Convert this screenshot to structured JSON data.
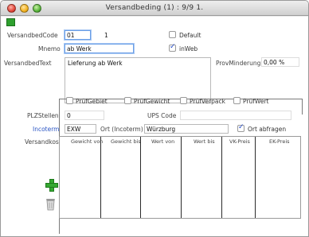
{
  "window": {
    "title": "Versandbeding (1) : 9/9 1."
  },
  "form": {
    "code_label": "VersandbedCode",
    "code_value": "01",
    "code_number": "1",
    "default_label": "Default",
    "default_checked": false,
    "mnemo_label": "Mnemo",
    "mnemo_value": "ab Werk",
    "inweb_label": "inWeb",
    "inweb_checked": true,
    "text_label": "VersandbedText",
    "text_value": "Lieferung ab Werk",
    "minderung_label": "ProvMinderung",
    "minderung_value": "0,00 %"
  },
  "checks": [
    {
      "label": "PrüfGebiet",
      "checked": false
    },
    {
      "label": "PrüfGewicht",
      "checked": false
    },
    {
      "label": "PrüfVerpack",
      "checked": false
    },
    {
      "label": "PrüfWert",
      "checked": false
    }
  ],
  "shipping": {
    "plz_label": "PLZStellen",
    "plz_value": "0",
    "ups_label": "UPS Code",
    "ups_value": "",
    "incoterm_label": "Incoterm",
    "incoterm_value": "EXW",
    "ort_label": "Ort (Incoterm)",
    "ort_value": "Würzburg",
    "ort_abfragen_label": "Ort abfragen",
    "ort_abfragen_checked": true
  },
  "table": {
    "label": "Versandkost",
    "columns": [
      "Gewicht von",
      "Gewicht bis",
      "Wert von",
      "Wert bis",
      "VK-Preis",
      "EK-Preis"
    ],
    "rows": []
  },
  "colors": {
    "accent_blue": "#2a55c4",
    "add_green": "#36a832"
  }
}
